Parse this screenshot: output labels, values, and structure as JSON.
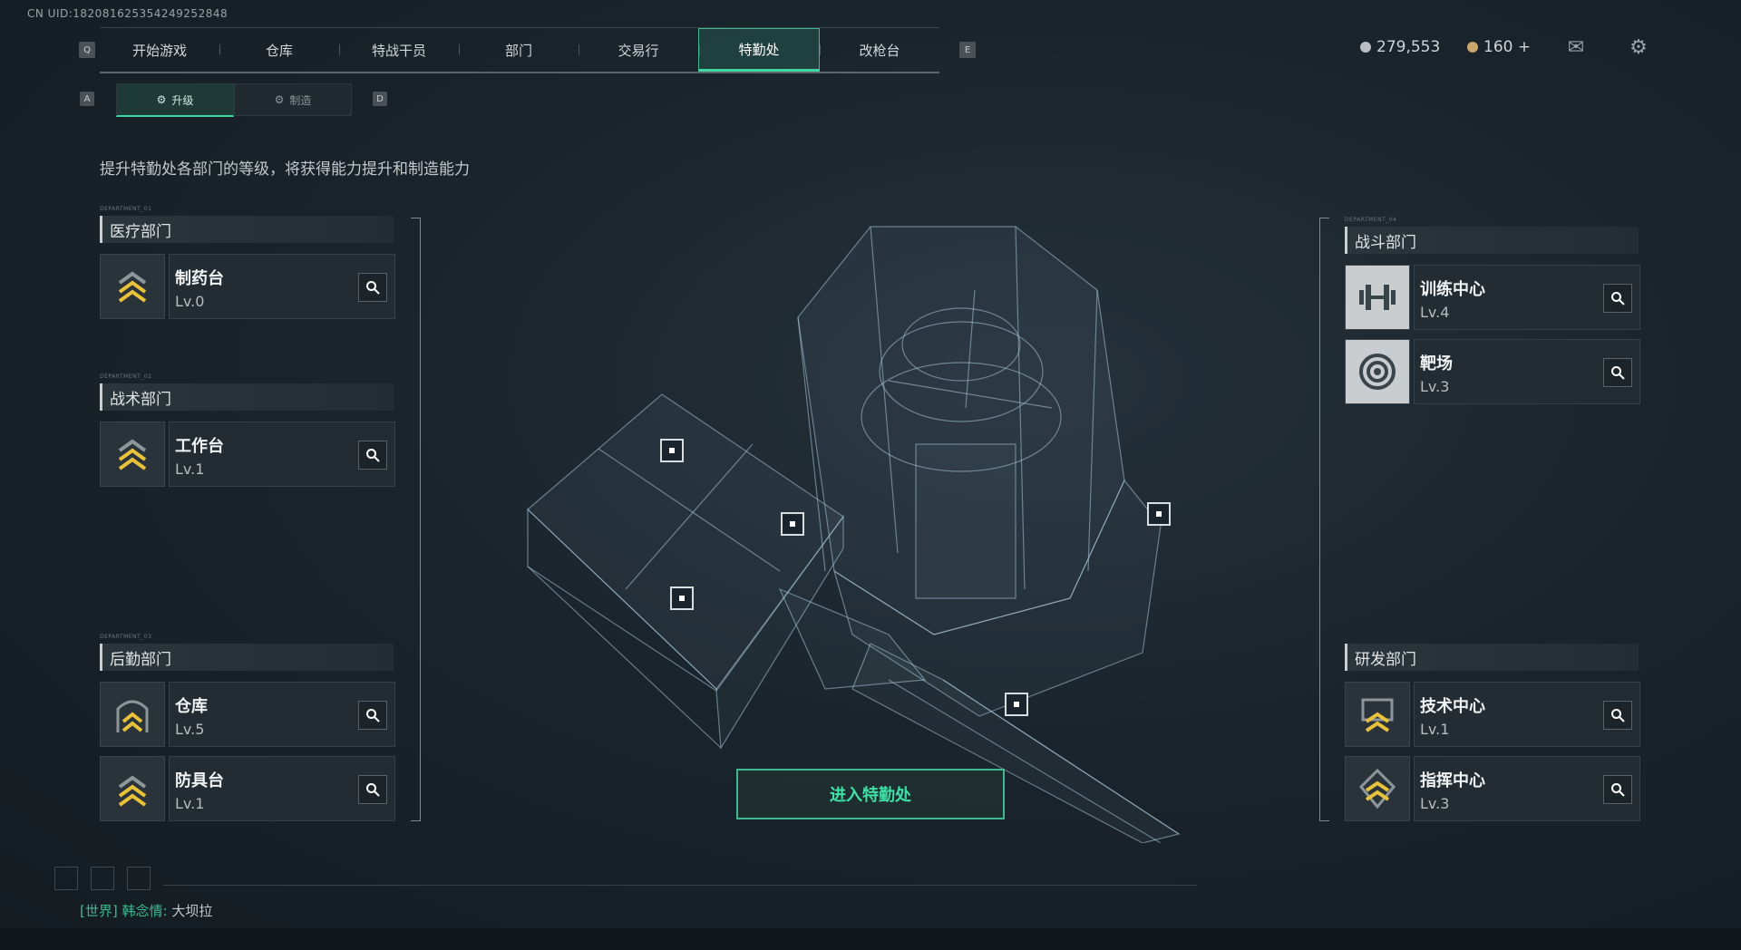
{
  "uid": "CN UID:18208162535424925284​8",
  "nav": {
    "left_key": "Q",
    "right_key": "E",
    "tabs": [
      "开始游戏",
      "仓库",
      "特战干员",
      "部门",
      "交易行",
      "特勤处",
      "改枪台"
    ],
    "active": 5
  },
  "subnav": {
    "left_key": "A",
    "right_key": "D",
    "tabs": [
      "升级",
      "制造"
    ],
    "active": 0
  },
  "currency": {
    "silver": "279,553",
    "gold": "160 +"
  },
  "description": "提升特勤处各部门的等级，将获得能力提升和制造能力",
  "departments": {
    "medical": {
      "tag": "DEPARTMENT_01",
      "title": "医疗部门",
      "items": [
        {
          "name": "制药台",
          "level": "Lv.0"
        }
      ]
    },
    "tactical": {
      "tag": "DEPARTMENT_02",
      "title": "战术部门",
      "items": [
        {
          "name": "工作台",
          "level": "Lv.1"
        }
      ]
    },
    "logistics": {
      "tag": "DEPARTMENT_03",
      "title": "后勤部门",
      "items": [
        {
          "name": "仓库",
          "level": "Lv.5"
        },
        {
          "name": "防具台",
          "level": "Lv.1"
        }
      ]
    },
    "combat": {
      "tag": "DEPARTMENT_04",
      "title": "战斗部门",
      "items": [
        {
          "name": "训练中心",
          "level": "Lv.4"
        },
        {
          "name": "靶场",
          "level": "Lv.3"
        }
      ]
    },
    "research": {
      "title": "研发部门",
      "items": [
        {
          "name": "技术中心",
          "level": "Lv.1"
        },
        {
          "name": "指挥中心",
          "level": "Lv.3"
        }
      ]
    }
  },
  "enter_button": "进入特勤处",
  "chat": {
    "channel": "[世界]",
    "user": "韩念情:",
    "message": "大坝拉"
  },
  "colors": {
    "accent": "#3fd6a0",
    "gold": "#e8c23a"
  }
}
